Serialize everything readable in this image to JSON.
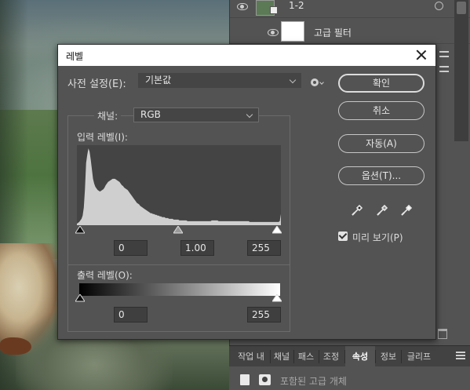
{
  "layers_panel": {
    "layer_name": "1-2",
    "smart_filter_label": "고급 필터"
  },
  "tabs": [
    "작업 내",
    "채널",
    "패스",
    "조정",
    "속성",
    "정보",
    "글리프"
  ],
  "active_tab": "속성",
  "properties": {
    "label": "포함된 고급 개체"
  },
  "dialog": {
    "title": "레벨",
    "preset_label": "사전 설정(E):",
    "preset_value": "기본값",
    "channel_label": "채널:",
    "channel_value": "RGB",
    "input_levels_label": "입력 레벨(I):",
    "input_values": [
      "0",
      "1.00",
      "255"
    ],
    "output_levels_label": "출력 레벨(O):",
    "output_values": [
      "0",
      "255"
    ],
    "buttons": {
      "ok": "확인",
      "cancel": "취소",
      "auto": "자동(A)",
      "options": "옵션(T)..."
    },
    "preview_label": "미리 보기(P)",
    "preview_checked": true
  },
  "histogram_data": [
    2,
    3,
    4,
    6,
    8,
    12,
    22,
    45,
    78,
    88,
    96,
    92,
    82,
    70,
    58,
    52,
    48,
    46,
    44,
    43,
    42,
    43,
    44,
    45,
    47,
    50,
    52,
    54,
    55,
    56,
    57,
    58,
    58,
    58,
    57,
    56,
    55,
    54,
    52,
    50,
    49,
    47,
    46,
    45,
    44,
    42,
    40,
    38,
    36,
    34,
    32,
    30,
    28,
    27,
    26,
    24,
    23,
    22,
    21,
    20,
    19,
    18,
    17,
    16,
    15,
    15,
    14,
    14,
    13,
    13,
    12,
    12,
    11,
    11,
    10,
    10,
    10,
    9,
    9,
    9,
    8,
    8,
    8,
    8,
    7,
    7,
    7,
    7,
    7,
    6,
    6,
    6,
    6,
    6,
    6,
    6,
    5,
    5,
    5,
    5,
    5,
    5,
    5,
    5,
    5,
    5,
    5,
    5,
    5,
    5,
    5,
    5,
    5,
    5,
    5,
    5,
    5,
    6,
    6,
    6,
    6,
    6,
    6,
    5,
    5,
    5,
    5,
    5,
    5,
    5,
    5,
    5,
    5,
    5,
    5,
    5,
    5,
    5,
    5,
    5,
    5,
    5,
    5,
    5,
    5,
    5,
    5,
    5,
    5,
    5,
    4,
    4,
    4,
    4,
    4,
    4,
    4,
    4,
    4,
    4,
    4,
    4,
    4,
    4,
    4,
    4,
    4,
    4,
    4,
    4,
    4,
    4,
    4,
    4,
    4,
    4,
    5,
    14
  ]
}
